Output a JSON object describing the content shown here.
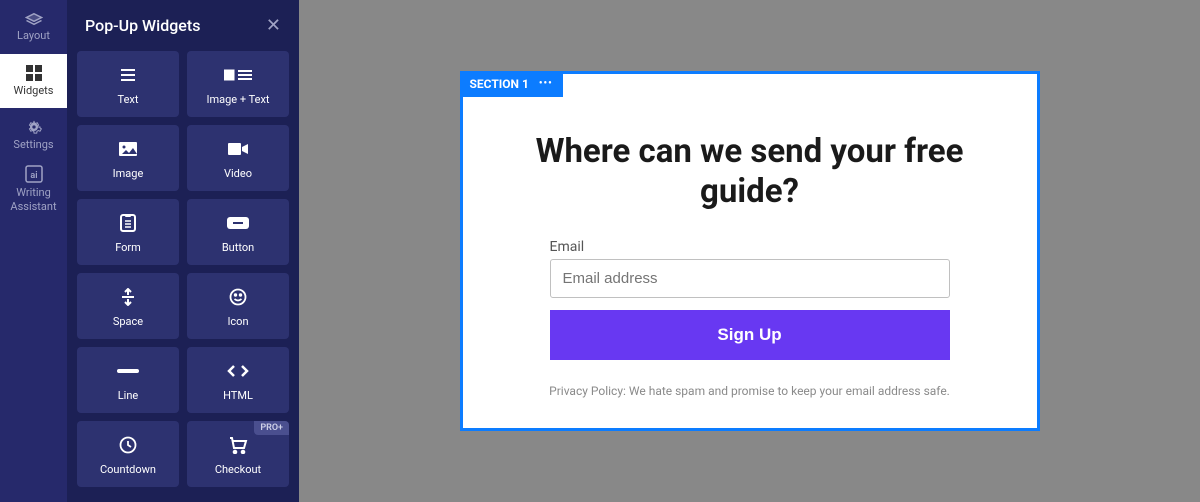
{
  "rail": {
    "items": [
      {
        "label": "Layout"
      },
      {
        "label": "Widgets"
      },
      {
        "label": "Settings"
      },
      {
        "label": "Writing Assistant"
      }
    ]
  },
  "panel": {
    "title": "Pop-Up Widgets",
    "widgets": [
      {
        "label": "Text"
      },
      {
        "label": "Image + Text"
      },
      {
        "label": "Image"
      },
      {
        "label": "Video"
      },
      {
        "label": "Form"
      },
      {
        "label": "Button"
      },
      {
        "label": "Space"
      },
      {
        "label": "Icon"
      },
      {
        "label": "Line"
      },
      {
        "label": "HTML"
      },
      {
        "label": "Countdown"
      },
      {
        "label": "Checkout",
        "badge": "PRO+"
      }
    ]
  },
  "section": {
    "tag": "SECTION 1",
    "heading": "Where can we send your free guide?",
    "email_label": "Email",
    "email_placeholder": "Email address",
    "button": "Sign Up",
    "privacy": "Privacy Policy: We hate spam and promise to keep your email address safe."
  }
}
